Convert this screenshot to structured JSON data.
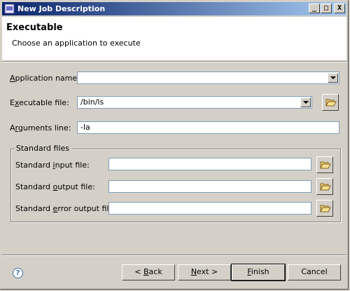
{
  "window": {
    "title": "New Job Description",
    "minimize": "_",
    "maximize": "□",
    "close": "X"
  },
  "header": {
    "title": "Executable",
    "description": "Choose an application to execute"
  },
  "form": {
    "application_name": {
      "label_pre": "",
      "label_key": "A",
      "label_post": "pplication name:",
      "value": ""
    },
    "executable_file": {
      "label_pre": "E",
      "label_key": "x",
      "label_post": "ecutable file:",
      "value": "/bin/ls"
    },
    "arguments_line": {
      "label_pre": "A",
      "label_key": "r",
      "label_post": "guments line:",
      "value": "-la"
    }
  },
  "standard_files": {
    "title": "Standard files",
    "input": {
      "label_pre": "Standard ",
      "label_key": "i",
      "label_post": "nput file:",
      "value": ""
    },
    "output": {
      "label_pre": "Standard ",
      "label_key": "o",
      "label_post": "utput file:",
      "value": ""
    },
    "error": {
      "label_pre": "Standard ",
      "label_key": "e",
      "label_post": "rror output file:",
      "value": ""
    }
  },
  "buttons": {
    "back": {
      "pre": "< ",
      "key": "B",
      "post": "ack"
    },
    "next": {
      "pre": "",
      "key": "N",
      "post": "ext >"
    },
    "finish": {
      "pre": "",
      "key": "F",
      "post": "inish"
    },
    "cancel": {
      "pre": "",
      "key": "",
      "post": "Cancel"
    }
  },
  "help": {
    "glyph": "?"
  },
  "icons": {
    "window": "app-icon",
    "folder": "folder-open-icon",
    "help": "help-icon",
    "dropdown": "chevron-down-icon"
  },
  "colors": {
    "title_gradient_start": "#0a246a",
    "title_gradient_end": "#a6caf0",
    "background": "#d4d0c8"
  }
}
